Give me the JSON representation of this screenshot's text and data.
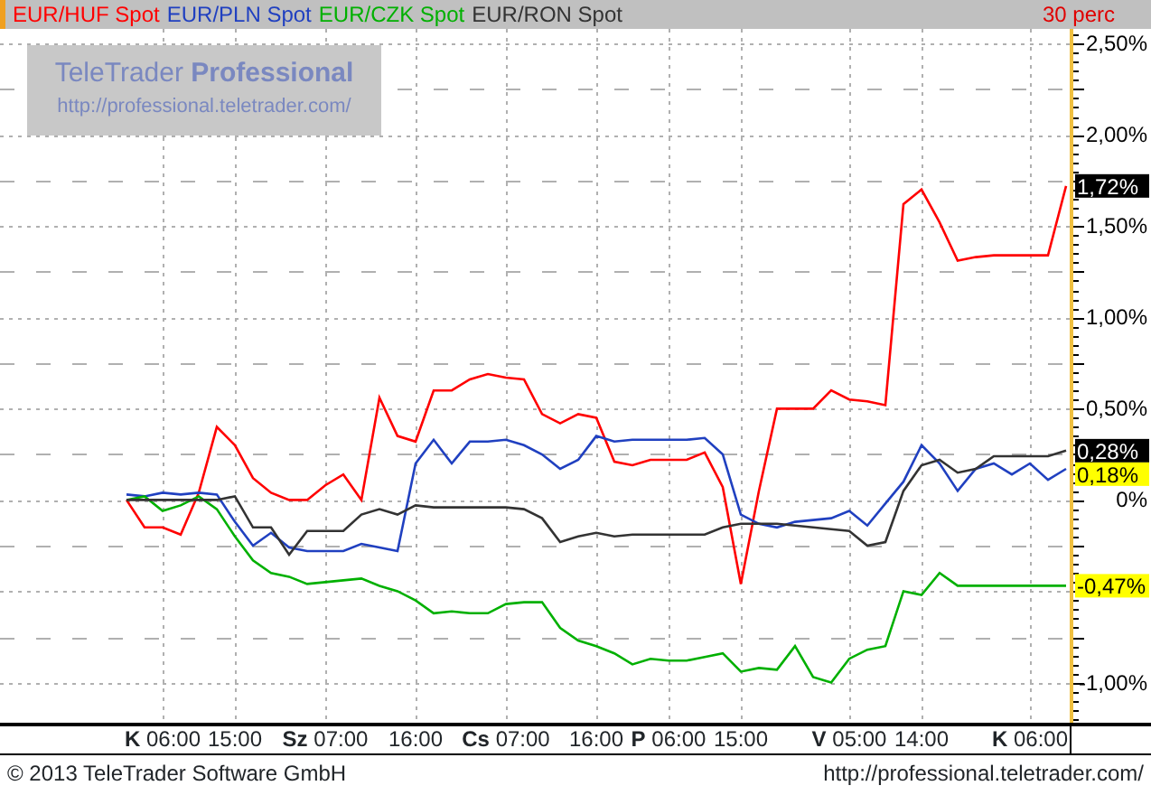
{
  "header": {
    "period": "30 perc"
  },
  "logo": {
    "title": "TeleTrader **Professional**",
    "url": "http://professional.teletrader.com/"
  },
  "chart": {
    "chart_data": {
      "type": "line",
      "categories": [
        null,
        null,
        "**K** 06:00",
        null,
        null,
        null,
        "15:00",
        null,
        null,
        null,
        null,
        "**Sz** 07:00",
        null,
        null,
        null,
        null,
        "16:00",
        null,
        null,
        null,
        null,
        "**Cs** 07:00",
        null,
        null,
        null,
        null,
        "16:00",
        null,
        null,
        null,
        "**P** 06:00",
        null,
        null,
        null,
        "15:00",
        null,
        null,
        null,
        null,
        null,
        "**V** 05:00",
        null,
        null,
        null,
        "14:00",
        null,
        null,
        null,
        null,
        null,
        "**K** 06:00",
        null,
        null
      ],
      "series": [
        {
          "name": "EUR/HUF Spot",
          "color": "#ff0000",
          "values": [
            0,
            -0.15,
            -0.15,
            -0.19,
            0.04,
            0.4,
            0.3,
            0.12,
            0.04,
            0,
            0,
            0.08,
            0.14,
            0,
            0.56,
            0.35,
            0.32,
            0.6,
            0.6,
            0.66,
            0.69,
            0.67,
            0.66,
            0.47,
            0.42,
            0.47,
            0.45,
            0.21,
            0.19,
            0.22,
            0.22,
            0.22,
            0.26,
            0.07,
            -0.46,
            0.05,
            0.5,
            0.5,
            0.5,
            0.6,
            0.55,
            0.54,
            0.52,
            1.62,
            1.7,
            1.52,
            1.31,
            1.33,
            1.34,
            1.34,
            1.34,
            1.34,
            1.72
          ]
        },
        {
          "name": "EUR/PLN Spot",
          "color": "#2040c0",
          "values": [
            0.03,
            0.02,
            0.04,
            0.03,
            0.04,
            0.03,
            -0.12,
            -0.25,
            -0.18,
            -0.26,
            -0.28,
            -0.28,
            -0.28,
            -0.24,
            -0.26,
            -0.28,
            0.2,
            0.33,
            0.2,
            0.32,
            0.32,
            0.33,
            0.3,
            0.25,
            0.17,
            0.22,
            0.35,
            0.32,
            0.33,
            0.33,
            0.33,
            0.33,
            0.34,
            0.25,
            -0.08,
            -0.13,
            -0.15,
            -0.12,
            -0.11,
            -0.1,
            -0.06,
            -0.14,
            -0.02,
            0.1,
            0.3,
            0.2,
            0.05,
            0.17,
            0.2,
            0.14,
            0.2,
            0.11,
            0.17
          ]
        },
        {
          "name": "EUR/CZK Spot",
          "color": "#00b000",
          "values": [
            0,
            0.02,
            -0.06,
            -0.03,
            0.02,
            -0.05,
            -0.2,
            -0.33,
            -0.4,
            -0.42,
            -0.46,
            -0.45,
            -0.44,
            -0.43,
            -0.47,
            -0.5,
            -0.55,
            -0.62,
            -0.61,
            -0.62,
            -0.62,
            -0.57,
            -0.56,
            -0.56,
            -0.7,
            -0.77,
            -0.8,
            -0.84,
            -0.9,
            -0.87,
            -0.88,
            -0.88,
            -0.86,
            -0.84,
            -0.94,
            -0.92,
            -0.93,
            -0.8,
            -0.97,
            -1.0,
            -0.87,
            -0.82,
            -0.8,
            -0.5,
            -0.52,
            -0.4,
            -0.47,
            -0.47,
            -0.47,
            -0.47,
            -0.47,
            -0.47,
            -0.47
          ]
        },
        {
          "name": "EUR/RON Spot",
          "color": "#333333",
          "values": [
            0,
            0,
            0,
            0,
            0,
            0,
            0.02,
            -0.15,
            -0.15,
            -0.3,
            -0.17,
            -0.17,
            -0.17,
            -0.08,
            -0.05,
            -0.08,
            -0.03,
            -0.04,
            -0.04,
            -0.04,
            -0.04,
            -0.04,
            -0.05,
            -0.1,
            -0.23,
            -0.2,
            -0.18,
            -0.2,
            -0.19,
            -0.19,
            -0.19,
            -0.19,
            -0.19,
            -0.15,
            -0.13,
            -0.13,
            -0.13,
            -0.14,
            -0.15,
            -0.16,
            -0.17,
            -0.25,
            -0.23,
            0.05,
            0.19,
            0.22,
            0.15,
            0.17,
            0.24,
            0.24,
            0.24,
            0.24,
            0.27
          ]
        }
      ],
      "ylim": [
        -1.22,
        2.58
      ],
      "grid": true,
      "yticks": [
        {
          "value": 2.5,
          "label": "2,50%"
        },
        {
          "value": 2,
          "label": "2,00%"
        },
        {
          "value": 1.5,
          "label": "1,50%"
        },
        {
          "value": 1,
          "label": "1,00%"
        },
        {
          "value": 0.5,
          "label": "0,50%"
        },
        {
          "value": 0,
          "label": "0%"
        },
        {
          "value": -1,
          "label": "-1,00%"
        }
      ]
    },
    "value_tags": [
      {
        "text": "1,72%",
        "highlighted": false
      },
      {
        "text": "0,28%",
        "highlighted": false
      },
      {
        "text": "0,18%",
        "highlighted": true
      },
      {
        "text": "-0,47%",
        "highlighted": true
      }
    ]
  },
  "footer": {
    "copyright": "© 2013 TeleTrader Software GmbH",
    "url": "http://professional.teletrader.com/"
  }
}
